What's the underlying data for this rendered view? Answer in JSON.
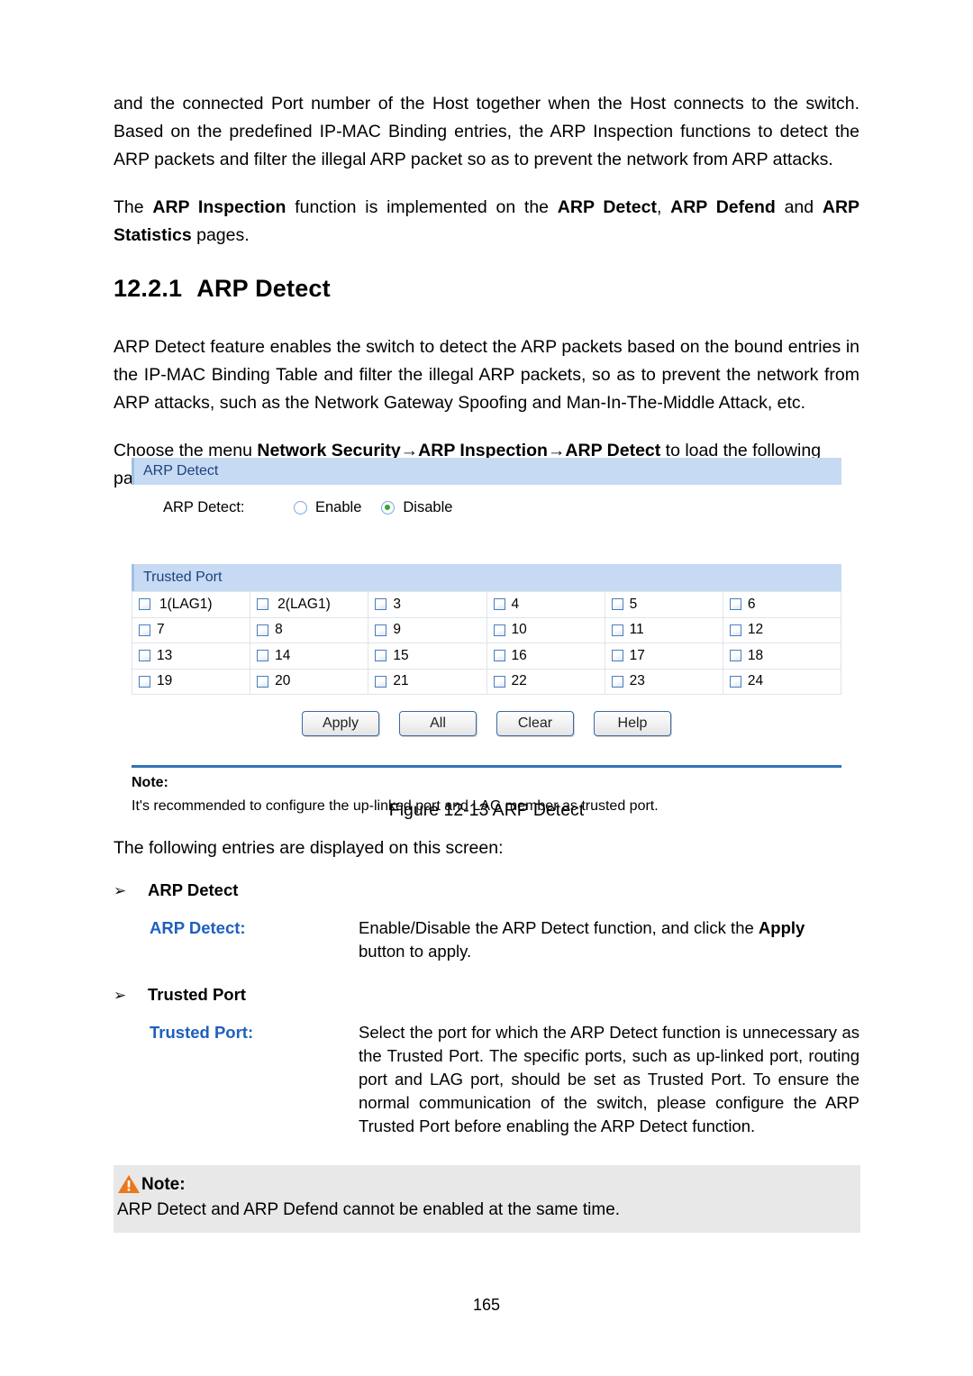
{
  "document": {
    "page_number": "165",
    "paragraphs": {
      "intro_1": "and the connected Port number of the Host together when the Host connects to the switch. Based on the predefined IP-MAC Binding entries, the ARP Inspection functions to detect the ARP packets and filter the illegal ARP packet so as to prevent the network from ARP attacks.",
      "intro_2_parts": {
        "t1": "The ",
        "b1": "ARP Inspection",
        "t2": " function is implemented on the ",
        "b2": "ARP Detect",
        "t3": ", ",
        "b3": "ARP Defend",
        "t4": " and ",
        "b4": "ARP Statistics",
        "t5": " pages."
      },
      "section_body": "ARP Detect feature enables the switch to detect the ARP packets based on the bound entries in the IP-MAC Binding Table and filter the illegal ARP packets, so as to prevent the network from ARP attacks, such as the Network Gateway Spoofing and Man-In-The-Middle Attack, etc.",
      "choose_menu_parts": {
        "t1": "Choose the menu ",
        "b1": "Network Security→ARP Inspection→ARP Detect",
        "t2": " to load the following page."
      },
      "intro_entries": "The following entries are displayed on this screen:"
    },
    "section": {
      "number": "12.2.1",
      "title": "ARP Detect"
    },
    "figure_caption": "Figure 12-13 ARP Detect"
  },
  "ui_panel": {
    "arp_detect_section": {
      "header": "ARP Detect",
      "field_label": "ARP Detect:",
      "radios": [
        {
          "label": "Enable",
          "checked": false
        },
        {
          "label": "Disable",
          "checked": true
        }
      ]
    },
    "trusted_port_section": {
      "header": "Trusted Port",
      "ports": [
        {
          "label": "1(LAG1)",
          "checked": false
        },
        {
          "label": "2(LAG1)",
          "checked": false
        },
        {
          "label": "3",
          "checked": false
        },
        {
          "label": "4",
          "checked": false
        },
        {
          "label": "5",
          "checked": false
        },
        {
          "label": "6",
          "checked": false
        },
        {
          "label": "7",
          "checked": false
        },
        {
          "label": "8",
          "checked": false
        },
        {
          "label": "9",
          "checked": false
        },
        {
          "label": "10",
          "checked": false
        },
        {
          "label": "11",
          "checked": false
        },
        {
          "label": "12",
          "checked": false
        },
        {
          "label": "13",
          "checked": false
        },
        {
          "label": "14",
          "checked": false
        },
        {
          "label": "15",
          "checked": false
        },
        {
          "label": "16",
          "checked": false
        },
        {
          "label": "17",
          "checked": false
        },
        {
          "label": "18",
          "checked": false
        },
        {
          "label": "19",
          "checked": false
        },
        {
          "label": "20",
          "checked": false
        },
        {
          "label": "21",
          "checked": false
        },
        {
          "label": "22",
          "checked": false
        },
        {
          "label": "23",
          "checked": false
        },
        {
          "label": "24",
          "checked": false
        }
      ]
    },
    "buttons": [
      {
        "label": "Apply"
      },
      {
        "label": "All"
      },
      {
        "label": "Clear"
      },
      {
        "label": "Help"
      }
    ],
    "panel_note": {
      "title": "Note:",
      "text": "It's recommended to configure the up-linked port and LAG member as trusted port."
    },
    "colors": {
      "header_bar": "#c6daf3",
      "header_text": "#204080",
      "rule": "#2e74b5",
      "radio_selected_dot": "#2fa82f",
      "checkbox_border": "#4a7ebb"
    }
  },
  "entries": {
    "bullet_1": "ARP Detect",
    "term_1": "ARP Detect:",
    "desc_1_parts": {
      "t1": "Enable/Disable the ARP Detect function, and click the ",
      "b1": "Apply",
      "t2": " button to apply."
    },
    "bullet_2": "Trusted Port",
    "term_2": "Trusted Port:",
    "desc_2": "Select the port for which the ARP Detect function is unnecessary as the Trusted Port. The specific ports, such as up-linked port, routing port and LAG port, should be set as Trusted Port. To ensure the normal communication of the switch, please configure the ARP Trusted Port before enabling the ARP Detect function.",
    "bullet_glyph": "➢"
  },
  "bottom_note": {
    "icon": "warning-triangle-icon",
    "title": "Note:",
    "text": "ARP Detect and ARP Defend cannot be enabled at the same time.",
    "icon_color": "#E8781E",
    "background": "#e8e8e8"
  }
}
